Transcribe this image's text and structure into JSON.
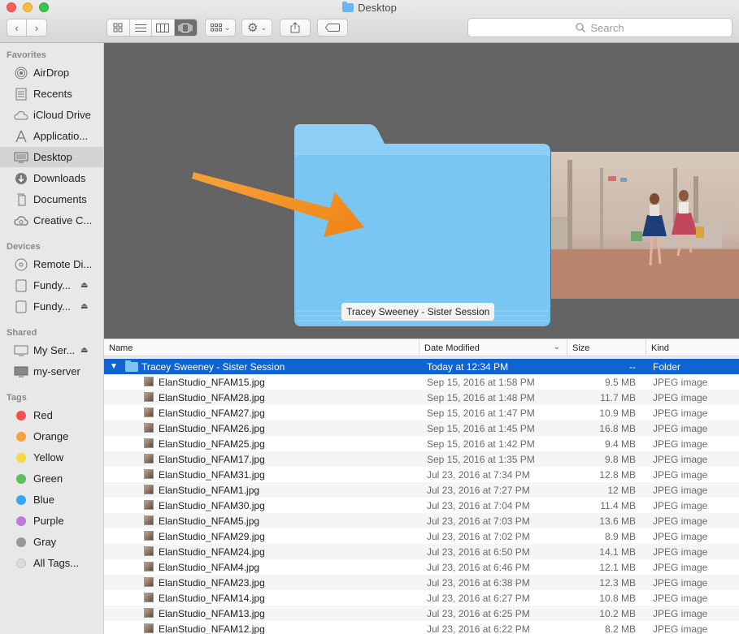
{
  "window": {
    "title": "Desktop"
  },
  "toolbar": {
    "search_placeholder": "Search"
  },
  "sidebar": {
    "favorites_heading": "Favorites",
    "favorites": [
      {
        "label": "AirDrop",
        "icon": "airdrop-icon"
      },
      {
        "label": "Recents",
        "icon": "recents-icon"
      },
      {
        "label": "iCloud Drive",
        "icon": "cloud-icon"
      },
      {
        "label": "Applicatio...",
        "icon": "applications-icon"
      },
      {
        "label": "Desktop",
        "icon": "desktop-icon"
      },
      {
        "label": "Downloads",
        "icon": "downloads-icon"
      },
      {
        "label": "Documents",
        "icon": "documents-icon"
      },
      {
        "label": "Creative C...",
        "icon": "creative-cloud-icon"
      }
    ],
    "devices_heading": "Devices",
    "devices": [
      {
        "label": "Remote Di...",
        "icon": "disc-icon"
      },
      {
        "label": "Fundy...",
        "icon": "drive-icon"
      },
      {
        "label": "Fundy...",
        "icon": "drive-icon"
      }
    ],
    "shared_heading": "Shared",
    "shared": [
      {
        "label": "My Ser...",
        "icon": "server-icon"
      },
      {
        "label": "my-server",
        "icon": "server-icon"
      }
    ],
    "tags_heading": "Tags",
    "tags": [
      {
        "label": "Red",
        "color": "#f0514f"
      },
      {
        "label": "Orange",
        "color": "#f6a13a"
      },
      {
        "label": "Yellow",
        "color": "#f7d844"
      },
      {
        "label": "Green",
        "color": "#5ac05a"
      },
      {
        "label": "Blue",
        "color": "#3aa5f3"
      },
      {
        "label": "Purple",
        "color": "#c07ad9"
      },
      {
        "label": "Gray",
        "color": "#979797"
      },
      {
        "label": "All Tags...",
        "color": "#dcdcdc"
      }
    ]
  },
  "preview": {
    "caption": "Tracey Sweeney - Sister Session"
  },
  "list": {
    "columns": {
      "name": "Name",
      "date": "Date Modified",
      "size": "Size",
      "kind": "Kind"
    },
    "folder": {
      "name": "Tracey Sweeney - Sister Session",
      "date": "Today at 12:34 PM",
      "size": "--",
      "kind": "Folder"
    },
    "files": [
      {
        "name": "ElanStudio_NFAM15.jpg",
        "date": "Sep 15, 2016 at 1:58 PM",
        "size": "9.5 MB",
        "kind": "JPEG image"
      },
      {
        "name": "ElanStudio_NFAM28.jpg",
        "date": "Sep 15, 2016 at 1:48 PM",
        "size": "11.7 MB",
        "kind": "JPEG image"
      },
      {
        "name": "ElanStudio_NFAM27.jpg",
        "date": "Sep 15, 2016 at 1:47 PM",
        "size": "10.9 MB",
        "kind": "JPEG image"
      },
      {
        "name": "ElanStudio_NFAM26.jpg",
        "date": "Sep 15, 2016 at 1:45 PM",
        "size": "16.8 MB",
        "kind": "JPEG image"
      },
      {
        "name": "ElanStudio_NFAM25.jpg",
        "date": "Sep 15, 2016 at 1:42 PM",
        "size": "9.4 MB",
        "kind": "JPEG image"
      },
      {
        "name": "ElanStudio_NFAM17.jpg",
        "date": "Sep 15, 2016 at 1:35 PM",
        "size": "9.8 MB",
        "kind": "JPEG image"
      },
      {
        "name": "ElanStudio_NFAM31.jpg",
        "date": "Jul 23, 2016 at 7:34 PM",
        "size": "12.8 MB",
        "kind": "JPEG image"
      },
      {
        "name": "ElanStudio_NFAM1.jpg",
        "date": "Jul 23, 2016 at 7:27 PM",
        "size": "12 MB",
        "kind": "JPEG image"
      },
      {
        "name": "ElanStudio_NFAM30.jpg",
        "date": "Jul 23, 2016 at 7:04 PM",
        "size": "11.4 MB",
        "kind": "JPEG image"
      },
      {
        "name": "ElanStudio_NFAM5.jpg",
        "date": "Jul 23, 2016 at 7:03 PM",
        "size": "13.6 MB",
        "kind": "JPEG image"
      },
      {
        "name": "ElanStudio_NFAM29.jpg",
        "date": "Jul 23, 2016 at 7:02 PM",
        "size": "8.9 MB",
        "kind": "JPEG image"
      },
      {
        "name": "ElanStudio_NFAM24.jpg",
        "date": "Jul 23, 2016 at 6:50 PM",
        "size": "14.1 MB",
        "kind": "JPEG image"
      },
      {
        "name": "ElanStudio_NFAM4.jpg",
        "date": "Jul 23, 2016 at 6:46 PM",
        "size": "12.1 MB",
        "kind": "JPEG image"
      },
      {
        "name": "ElanStudio_NFAM23.jpg",
        "date": "Jul 23, 2016 at 6:38 PM",
        "size": "12.3 MB",
        "kind": "JPEG image"
      },
      {
        "name": "ElanStudio_NFAM14.jpg",
        "date": "Jul 23, 2016 at 6:27 PM",
        "size": "10.8 MB",
        "kind": "JPEG image"
      },
      {
        "name": "ElanStudio_NFAM13.jpg",
        "date": "Jul 23, 2016 at 6:25 PM",
        "size": "10.2 MB",
        "kind": "JPEG image"
      },
      {
        "name": "ElanStudio_NFAM12.jpg",
        "date": "Jul 23, 2016 at 6:22 PM",
        "size": "8.2 MB",
        "kind": "JPEG image"
      }
    ]
  }
}
